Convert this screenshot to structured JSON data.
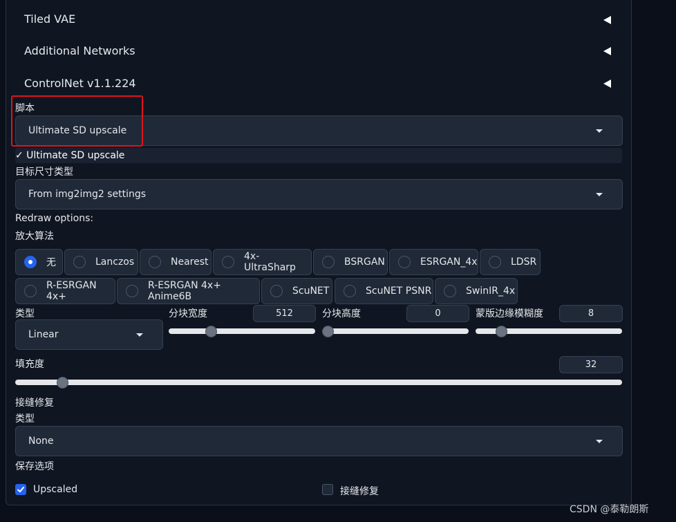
{
  "accordions": [
    {
      "label": "Tiled VAE"
    },
    {
      "label": "Additional Networks"
    },
    {
      "label": "ControlNet v1.1.224"
    }
  ],
  "script": {
    "label": "脚本",
    "value": "Ultimate SD upscale",
    "open_option": "✓ Ultimate SD upscale"
  },
  "target_size": {
    "label": "目标尺寸类型",
    "value": "From img2img2 settings"
  },
  "redraw": {
    "heading": "Redraw options:",
    "upscaler_label": "放大算法",
    "upscalers": [
      "无",
      "Lanczos",
      "Nearest",
      "4x-UltraSharp",
      "BSRGAN",
      "ESRGAN_4x",
      "LDSR",
      "R-ESRGAN 4x+",
      "R-ESRGAN 4x+ Anime6B",
      "ScuNET",
      "ScuNET PSNR",
      "SwinIR_4x"
    ],
    "selected_upscaler": "无",
    "type_label": "类型",
    "type_value": "Linear",
    "tile_width": {
      "label": "分块宽度",
      "value": "512",
      "fraction": 0.27
    },
    "tile_height": {
      "label": "分块高度",
      "value": "0",
      "fraction": 0.0
    },
    "mask_blur": {
      "label": "蒙版边缘模糊度",
      "value": "8",
      "fraction": 0.15
    },
    "padding": {
      "label": "填充度",
      "value": "32",
      "fraction": 0.07
    }
  },
  "seams_fix": {
    "heading": "接缝修复",
    "type_label": "类型",
    "type_value": "None"
  },
  "save_options": {
    "heading": "保存选项",
    "upscaled": {
      "label": "Upscaled",
      "checked": true
    },
    "seams_fix": {
      "label": "接缝修复",
      "checked": false
    }
  },
  "watermark": "CSDN @泰勒朗斯",
  "colors": {
    "accent": "#2563eb",
    "highlight": "#e0141e"
  }
}
